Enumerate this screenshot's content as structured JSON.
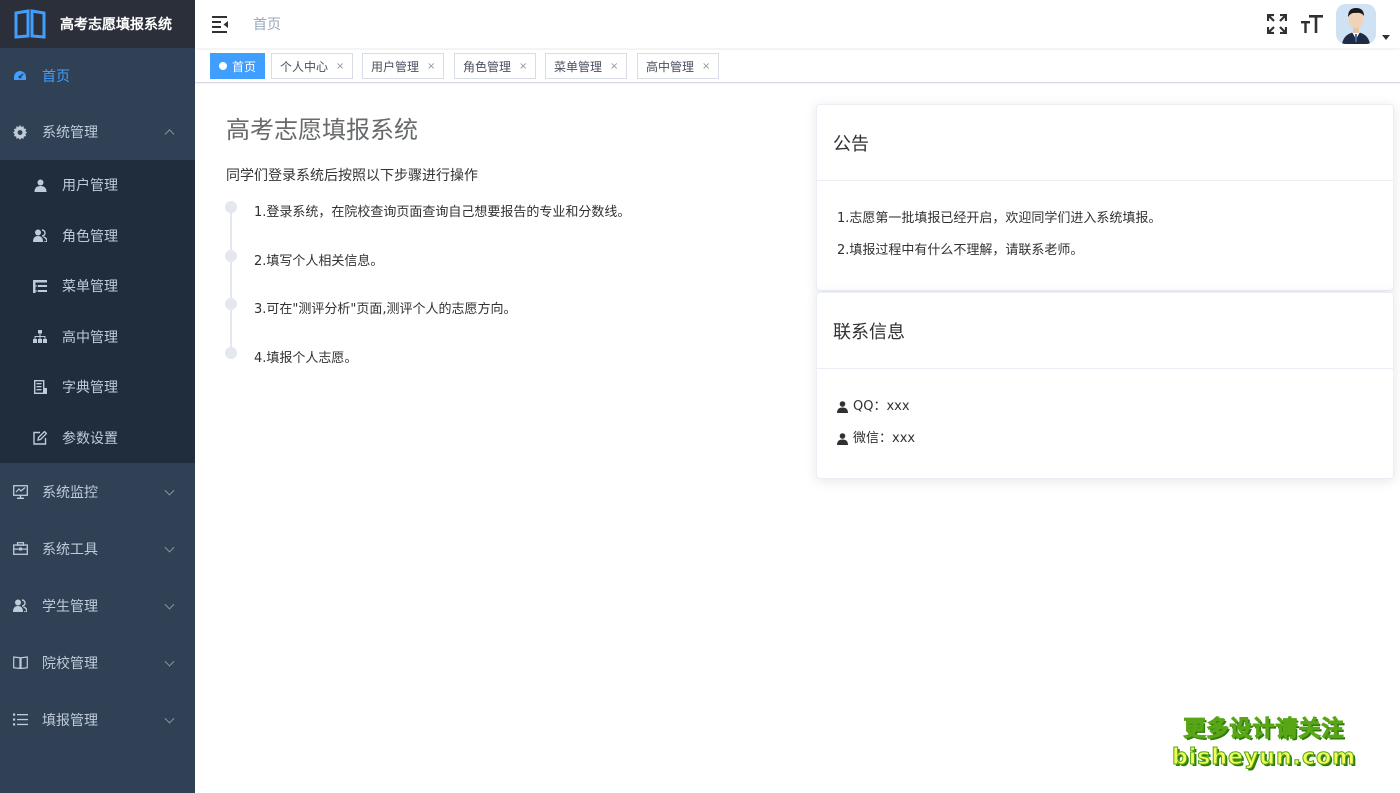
{
  "app": {
    "title": "高考志愿填报系统"
  },
  "sidebar": {
    "items": [
      {
        "label": "首页",
        "icon": "dashboard-icon",
        "active": true
      },
      {
        "label": "系统管理",
        "icon": "gear-icon",
        "expanded": true,
        "children": [
          {
            "label": "用户管理",
            "icon": "user-icon"
          },
          {
            "label": "角色管理",
            "icon": "peoples-icon"
          },
          {
            "label": "菜单管理",
            "icon": "tree-table-icon"
          },
          {
            "label": "高中管理",
            "icon": "tree-icon"
          },
          {
            "label": "字典管理",
            "icon": "dict-icon"
          },
          {
            "label": "参数设置",
            "icon": "edit-icon"
          }
        ]
      },
      {
        "label": "系统监控",
        "icon": "monitor-icon"
      },
      {
        "label": "系统工具",
        "icon": "toolbox-icon"
      },
      {
        "label": "学生管理",
        "icon": "peoples-icon"
      },
      {
        "label": "院校管理",
        "icon": "book-icon"
      },
      {
        "label": "填报管理",
        "icon": "list-icon"
      }
    ]
  },
  "navbar": {
    "breadcrumb": "首页",
    "icons": [
      "fullscreen-icon",
      "font-size-icon",
      "avatar"
    ]
  },
  "tags": [
    {
      "label": "首页",
      "active": true
    },
    {
      "label": "个人中心",
      "close": "×"
    },
    {
      "label": "用户管理",
      "close": "×"
    },
    {
      "label": "角色管理",
      "close": "×"
    },
    {
      "label": "菜单管理",
      "close": "×"
    },
    {
      "label": "高中管理",
      "close": "×"
    }
  ],
  "main": {
    "title": "高考志愿填报系统",
    "subtitle": "同学们登录系统后按照以下步骤进行操作",
    "steps": [
      "1.登录系统，在院校查询页面查询自己想要报告的专业和分数线。",
      "2.填写个人相关信息。",
      "3.可在\"测评分析\"页面,测评个人的志愿方向。",
      "4.填报个人志愿。"
    ]
  },
  "notice": {
    "title": "公告",
    "lines": [
      "1.志愿第一批填报已经开启，欢迎同学们进入系统填报。",
      "2.填报过程中有什么不理解，请联系老师。"
    ]
  },
  "contact": {
    "title": "联系信息",
    "lines": [
      "QQ：xxx",
      "微信：xxx"
    ]
  },
  "watermark": {
    "line1": "更多设计请关注",
    "line2": "bisheyun.com"
  },
  "colors": {
    "sidebar_bg": "#304156",
    "submenu_bg": "#1f2d3d",
    "accent": "#409eff",
    "menu_text": "#bfcbd9"
  }
}
